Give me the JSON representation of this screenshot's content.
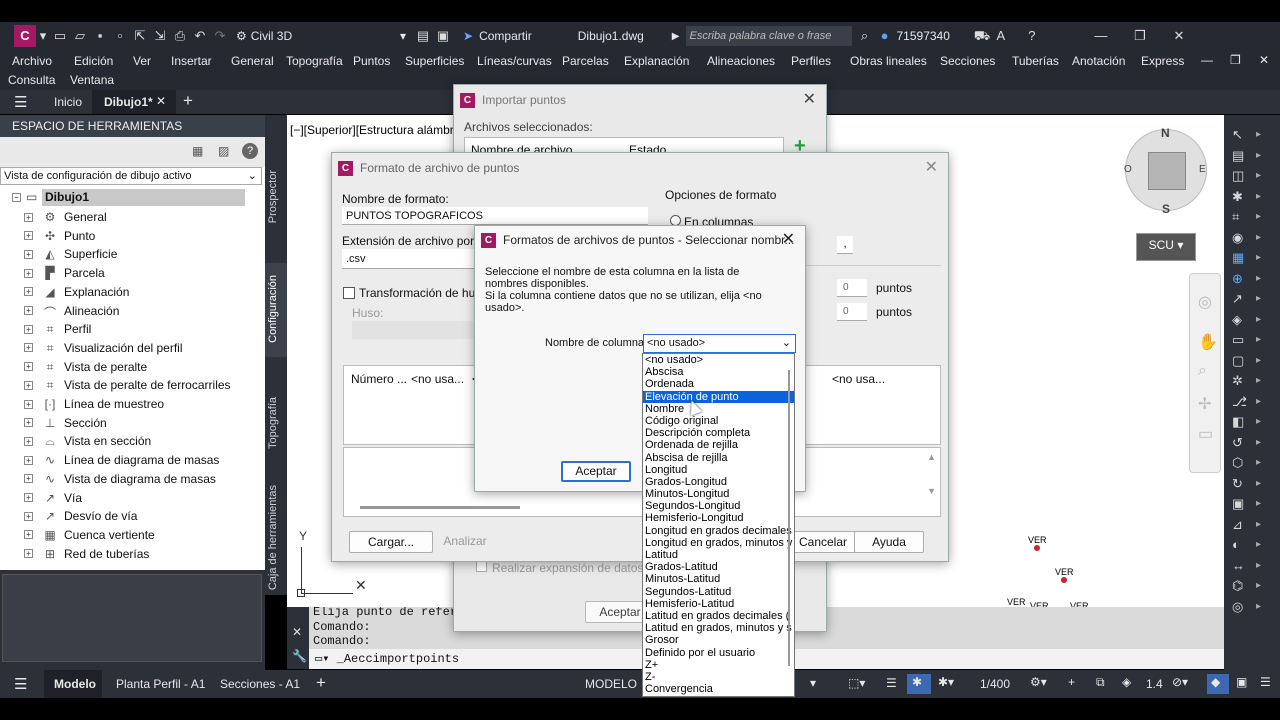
{
  "app": {
    "workspace": "Civil 3D",
    "share_label": "Compartir",
    "file_name": "Dibujo1.dwg",
    "search_placeholder": "Escriba palabra clave o frase",
    "user_id": "71597340",
    "brand_color": "#a31a63"
  },
  "menu": {
    "row1": [
      "Archivo",
      "Edición",
      "Ver",
      "Insertar",
      "General",
      "Topografía",
      "Puntos",
      "Superficies",
      "Líneas/curvas",
      "Parcelas",
      "Explanación",
      "Alineaciones",
      "Perfiles",
      "Obras lineales",
      "Secciones",
      "Tuberías",
      "Anotación",
      "Express"
    ],
    "row2": [
      "Consulta",
      "Ventana"
    ]
  },
  "tabs": {
    "home": "Inicio",
    "doc": "Dibujo1*"
  },
  "toolspace": {
    "header": "ESPACIO DE HERRAMIENTAS",
    "view_select": "Vista de configuración de dibujo activo",
    "root": "Dibujo1",
    "items": [
      "General",
      "Punto",
      "Superficie",
      "Parcela",
      "Explanación",
      "Alineación",
      "Perfil",
      "Visualización del perfil",
      "Vista de peralte",
      "Vista de peralte de ferrocarriles",
      "Línea de muestreo",
      "Sección",
      "Vista en sección",
      "Línea de diagrama de masas",
      "Vista de diagrama de masas",
      "Vía",
      "Desvío de vía",
      "Cuenca vertiente",
      "Red de tuberías"
    ],
    "vtabs": [
      "Prospector",
      "Configuración",
      "Topografía",
      "Caja de herramientas"
    ]
  },
  "viewport": {
    "label": "[−][Superior][Estructura alámbrica",
    "compass_n": "N",
    "compass_s": "S",
    "compass_e": "E",
    "compass_w": "O",
    "ucs": "SCU",
    "points": [
      "VER",
      "VER",
      "VER",
      "VER",
      "VER"
    ]
  },
  "command": {
    "line1": "Elija punto de referencia",
    "line2": "Comando:",
    "line3": "Comando:",
    "input": "_Aeccimportpoints"
  },
  "status": {
    "model_tab": "Modelo",
    "layout1": "Planta Perfil - A1",
    "layout2": "Secciones - A1",
    "mode": "MODELO",
    "scale": "1/400",
    "annot": "1.4"
  },
  "import_dialog": {
    "title": "Importar puntos",
    "files_label": "Archivos seleccionados:",
    "col_name": "Nombre de archivo",
    "col_state": "Estado",
    "expand_checkbox": "Realizar expansión de datos de co",
    "ok": "Aceptar"
  },
  "format_dialog": {
    "title": "Formato de archivo de puntos",
    "format_name_label": "Nombre de formato:",
    "format_name_value": "PUNTOS TOPOGRAFICOS",
    "ext_label": "Extensión de archivo por defe",
    "ext_value": ".csv",
    "zone_checkbox": "Transformación de huso de",
    "huso_label": "Huso:",
    "options_label": "Opciones de formato",
    "columns_radio": "En columnas",
    "delimiter": ",",
    "skip1": "0",
    "skip1_unit": "puntos",
    "skip2": "0",
    "skip2_unit": "puntos",
    "grid_cols": [
      "Número ...",
      "<no usa...",
      "<",
      "<no usa..."
    ],
    "load": "Cargar...",
    "analyze": "Analizar",
    "cancel": "Cancelar",
    "help": "Ayuda"
  },
  "select_dialog": {
    "title": "Formatos de archivos de puntos - Seleccionar nombr...",
    "instruction1": "Seleccione el nombre de esta columna en la lista de nombres disponibles.",
    "instruction2": "Si la columna contiene datos que no se utilizan, elija <no usado>.",
    "column_label": "Nombre de columna:",
    "column_value": "<no usado>",
    "ok": "Aceptar"
  },
  "dropdown": {
    "selected_index": 3,
    "options": [
      "<no usado>",
      "Abscisa",
      "Ordenada",
      "Elevación de punto",
      "Nombre",
      "Código original",
      "Descripción completa",
      "Ordenada de rejilla",
      "Abscisa de rejilla",
      "Longitud",
      "Grados-Longitud",
      "Minutos-Longitud",
      "Segundos-Longitud",
      "Hemisferio-Longitud",
      "Longitud en grados decimales",
      "Longitud en grados, minutos y",
      "Latitud",
      "Grados-Latitud",
      "Minutos-Latitud",
      "Segundos-Latitud",
      "Hemisferio-Latitud",
      "Latitud en grados decimales (",
      "Latitud en grados, minutos y s",
      "Grosor",
      "Definido por el usuario",
      "Z+",
      "Z-",
      "Convergencia"
    ]
  }
}
